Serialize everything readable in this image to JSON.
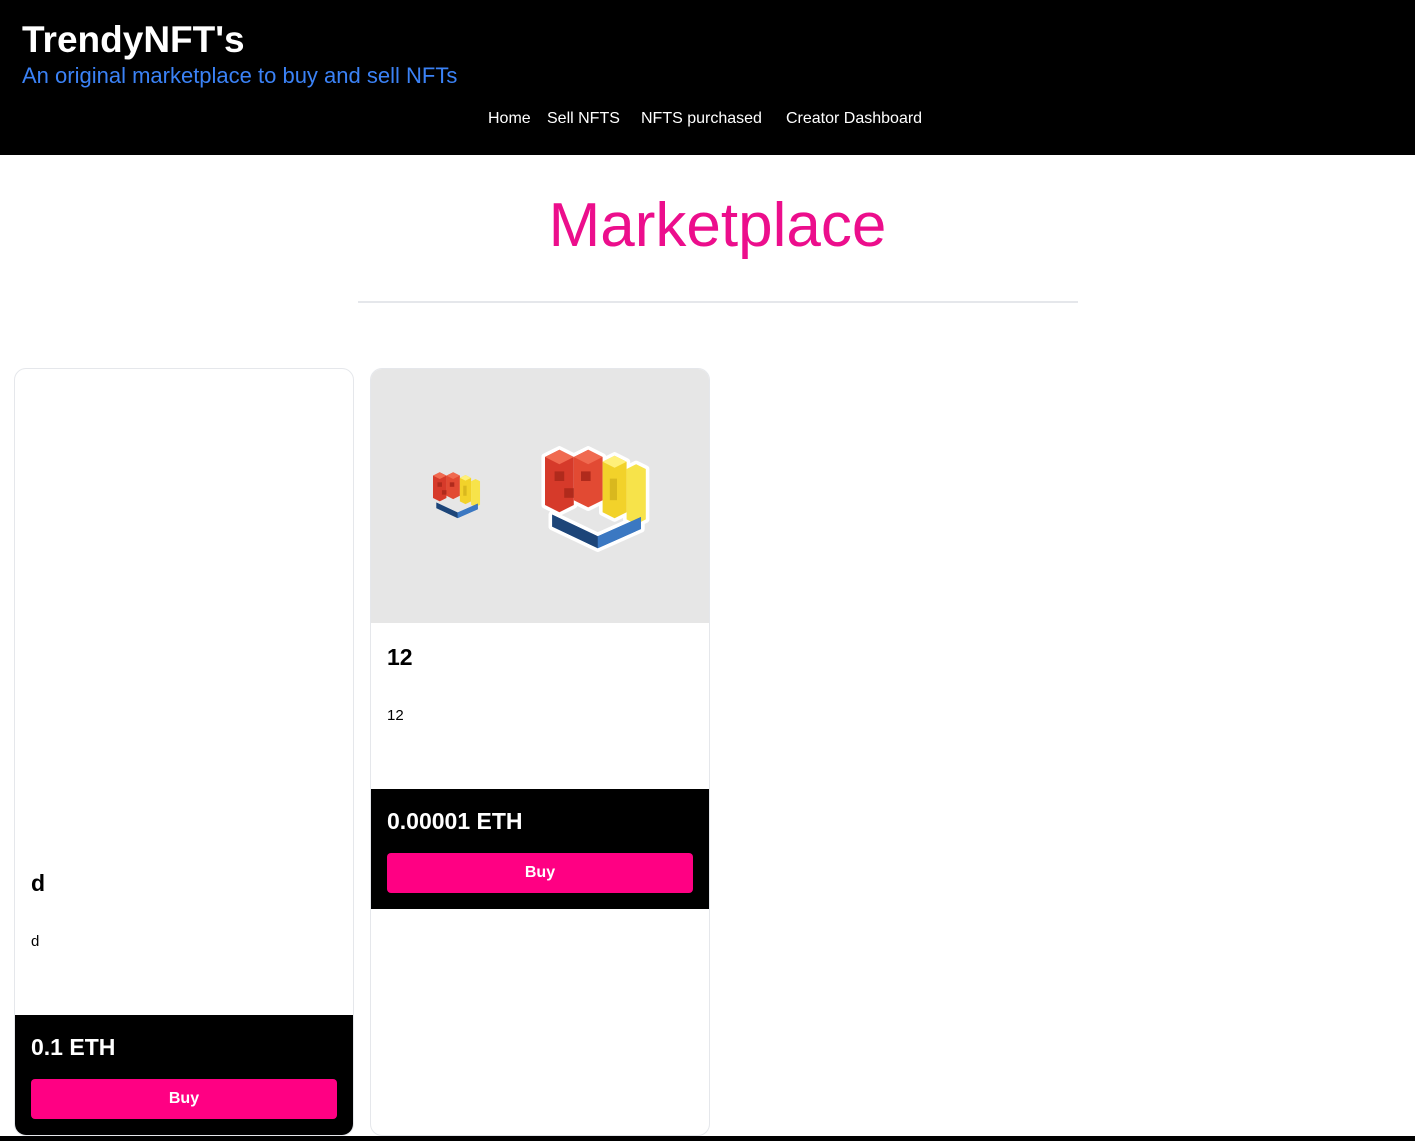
{
  "header": {
    "title": "TrendyNFT's",
    "tagline": "An original marketplace to buy and sell NFTs",
    "nav": [
      "Home",
      "Sell NFTS",
      "NFTS purchased",
      "Creator Dashboard"
    ]
  },
  "main": {
    "title": "Marketplace",
    "cards": [
      {
        "name": "d",
        "description": "d",
        "price": "0.1 ETH",
        "buy_label": "Buy",
        "image": "none"
      },
      {
        "name": "12",
        "description": "12",
        "price": "0.00001 ETH",
        "buy_label": "Buy",
        "image": "matlab-logo-icon"
      }
    ]
  },
  "colors": {
    "header_bg": "#000000",
    "tagline": "#3b82f6",
    "title": "#ec0e8c",
    "buy_button": "#ff0083",
    "image_bg": "#e6e6e6"
  }
}
